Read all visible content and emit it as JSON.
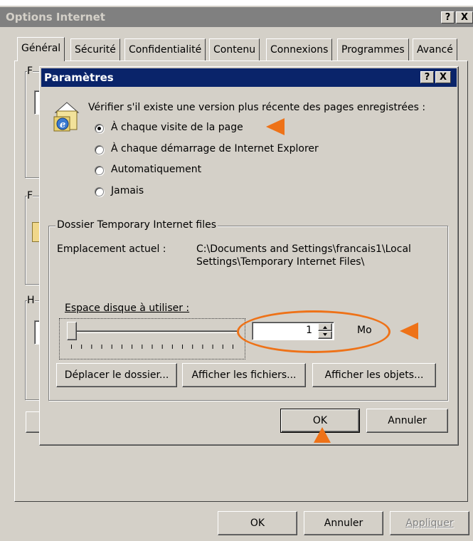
{
  "colors": {
    "title_active": "#0a246a",
    "title_inactive": "#808080",
    "dialog_face": "#d4d0c8",
    "annotation": "#ee7218"
  },
  "parent_window": {
    "title": "Options Internet",
    "help_label": "?",
    "close_label": "X",
    "tabs": [
      "Général",
      "Sécurité",
      "Confidentialité",
      "Contenu",
      "Connexions",
      "Programmes",
      "Avancé"
    ],
    "ok_label": "OK",
    "cancel_label": "Annuler",
    "apply_label": "Appliquer",
    "group_stubs": [
      "F",
      "F",
      "H"
    ]
  },
  "dialog": {
    "title": "Paramètres",
    "help_label": "?",
    "close_label": "X",
    "icon": "ie-page-folder-icon",
    "question": "Vérifier s'il existe une version plus récente des pages enregistrées :",
    "options": [
      {
        "label": "À chaque visite de la page",
        "selected": true
      },
      {
        "label": "À chaque démarrage de Internet Explorer",
        "selected": false
      },
      {
        "label": "Automatiquement",
        "selected": false
      },
      {
        "label": "Jamais",
        "selected": false
      }
    ],
    "temp_group": {
      "title": "Dossier Temporary Internet files",
      "location_label": "Emplacement actuel :",
      "location_line1": "C:\\Documents and Settings\\francais1\\Local",
      "location_line2": "Settings\\Temporary Internet Files\\",
      "disk_label": "Espace disque à utiliser :",
      "slider_level": 0,
      "disk_value": "1",
      "unit": "Mo",
      "move_button": "Déplacer le dossier...",
      "view_files_button": "Afficher les fichiers...",
      "view_objects_button": "Afficher les objets..."
    },
    "ok_label": "OK",
    "cancel_label": "Annuler"
  }
}
